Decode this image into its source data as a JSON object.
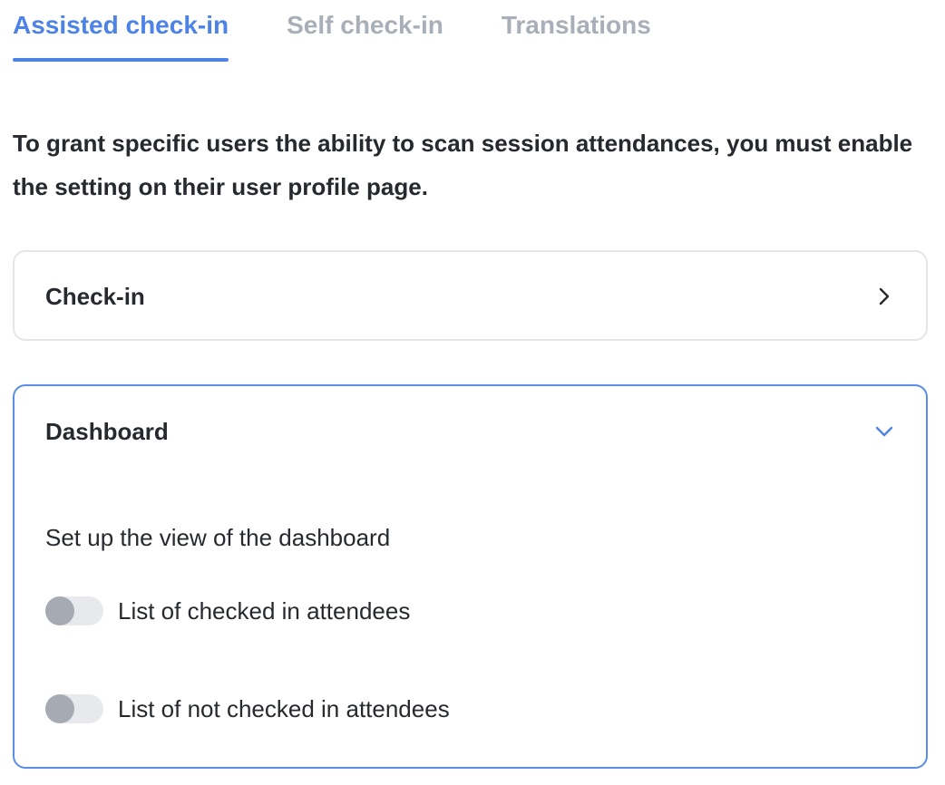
{
  "tabs": [
    {
      "label": "Assisted check-in",
      "active": true
    },
    {
      "label": "Self check-in",
      "active": false
    },
    {
      "label": "Translations",
      "active": false
    }
  ],
  "info_text": "To grant specific users the ability to scan session attendances, you must enable the setting on their user profile page.",
  "checkin_card": {
    "title": "Check-in",
    "icon": "chevron-right-icon",
    "expanded": false
  },
  "dashboard_card": {
    "title": "Dashboard",
    "icon": "chevron-down-icon",
    "expanded": true,
    "section_label": "Set up the view of the dashboard",
    "toggles": [
      {
        "label": "List of checked in attendees",
        "on": false
      },
      {
        "label": "List of not checked in attendees",
        "on": false
      }
    ]
  },
  "colors": {
    "accent": "#4d82e6",
    "tab_inactive": "#a9afb8",
    "text": "#26292e",
    "card_border": "#e4e6ea",
    "card_border_active": "#5a8de6",
    "toggle_track": "#e7e9ec",
    "toggle_knob": "#a6abb3"
  }
}
